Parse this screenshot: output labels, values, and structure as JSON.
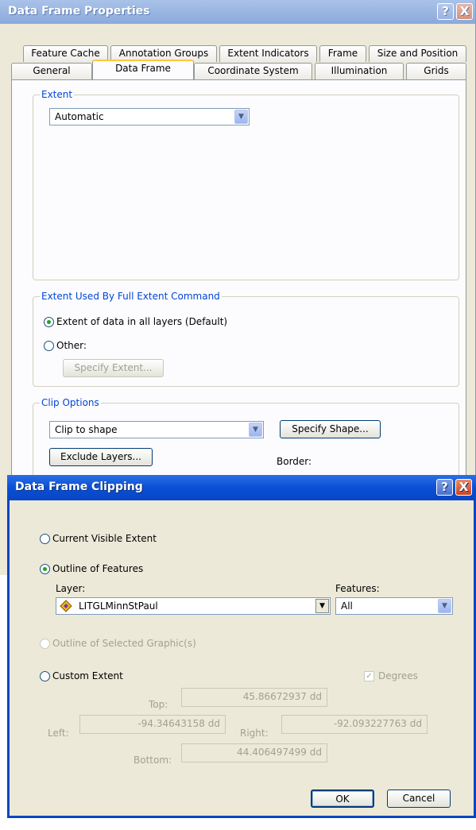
{
  "back_window": {
    "title": "Data Frame Properties",
    "help_glyph": "?",
    "close_glyph": "X",
    "tabs_row1": [
      "Feature Cache",
      "Annotation Groups",
      "Extent Indicators",
      "Frame",
      "Size and Position"
    ],
    "tabs_row2": [
      "General",
      "Data Frame",
      "Coordinate System",
      "Illumination",
      "Grids"
    ],
    "selected_tab": "Data Frame",
    "extent": {
      "label": "Extent",
      "value": "Automatic"
    },
    "full_extent": {
      "label": "Extent Used By Full Extent Command",
      "option_default": "Extent of data in all layers (Default)",
      "option_other": "Other:",
      "specify_button": "Specify Extent..."
    },
    "clip": {
      "label": "Clip Options",
      "value": "Clip to shape",
      "specify_shape_button": "Specify Shape...",
      "exclude_button": "Exclude Layers...",
      "border_label": "Border:"
    }
  },
  "front_dialog": {
    "title": "Data Frame Clipping",
    "help_glyph": "?",
    "close_glyph": "X",
    "opt_current": "Current Visible Extent",
    "opt_outline": "Outline of Features",
    "layer_label": "Layer:",
    "layer_value": "LITGLMinnStPaul",
    "features_label": "Features:",
    "features_value": "All",
    "opt_selected": "Outline of Selected Graphic(s)",
    "opt_custom": "Custom Extent",
    "degrees_label": "Degrees",
    "top_label": "Top:",
    "top_value": "45.86672937 dd",
    "left_label": "Left:",
    "left_value": "-94.34643158 dd",
    "right_label": "Right:",
    "right_value": "-92.093227763 dd",
    "bottom_label": "Bottom:",
    "bottom_value": "44.406497499 dd",
    "ok_button": "OK",
    "cancel_button": "Cancel"
  },
  "colors": {
    "accent": "#0846c4",
    "group_label": "#0046d5",
    "dialog_bg": "#ece9d8"
  }
}
